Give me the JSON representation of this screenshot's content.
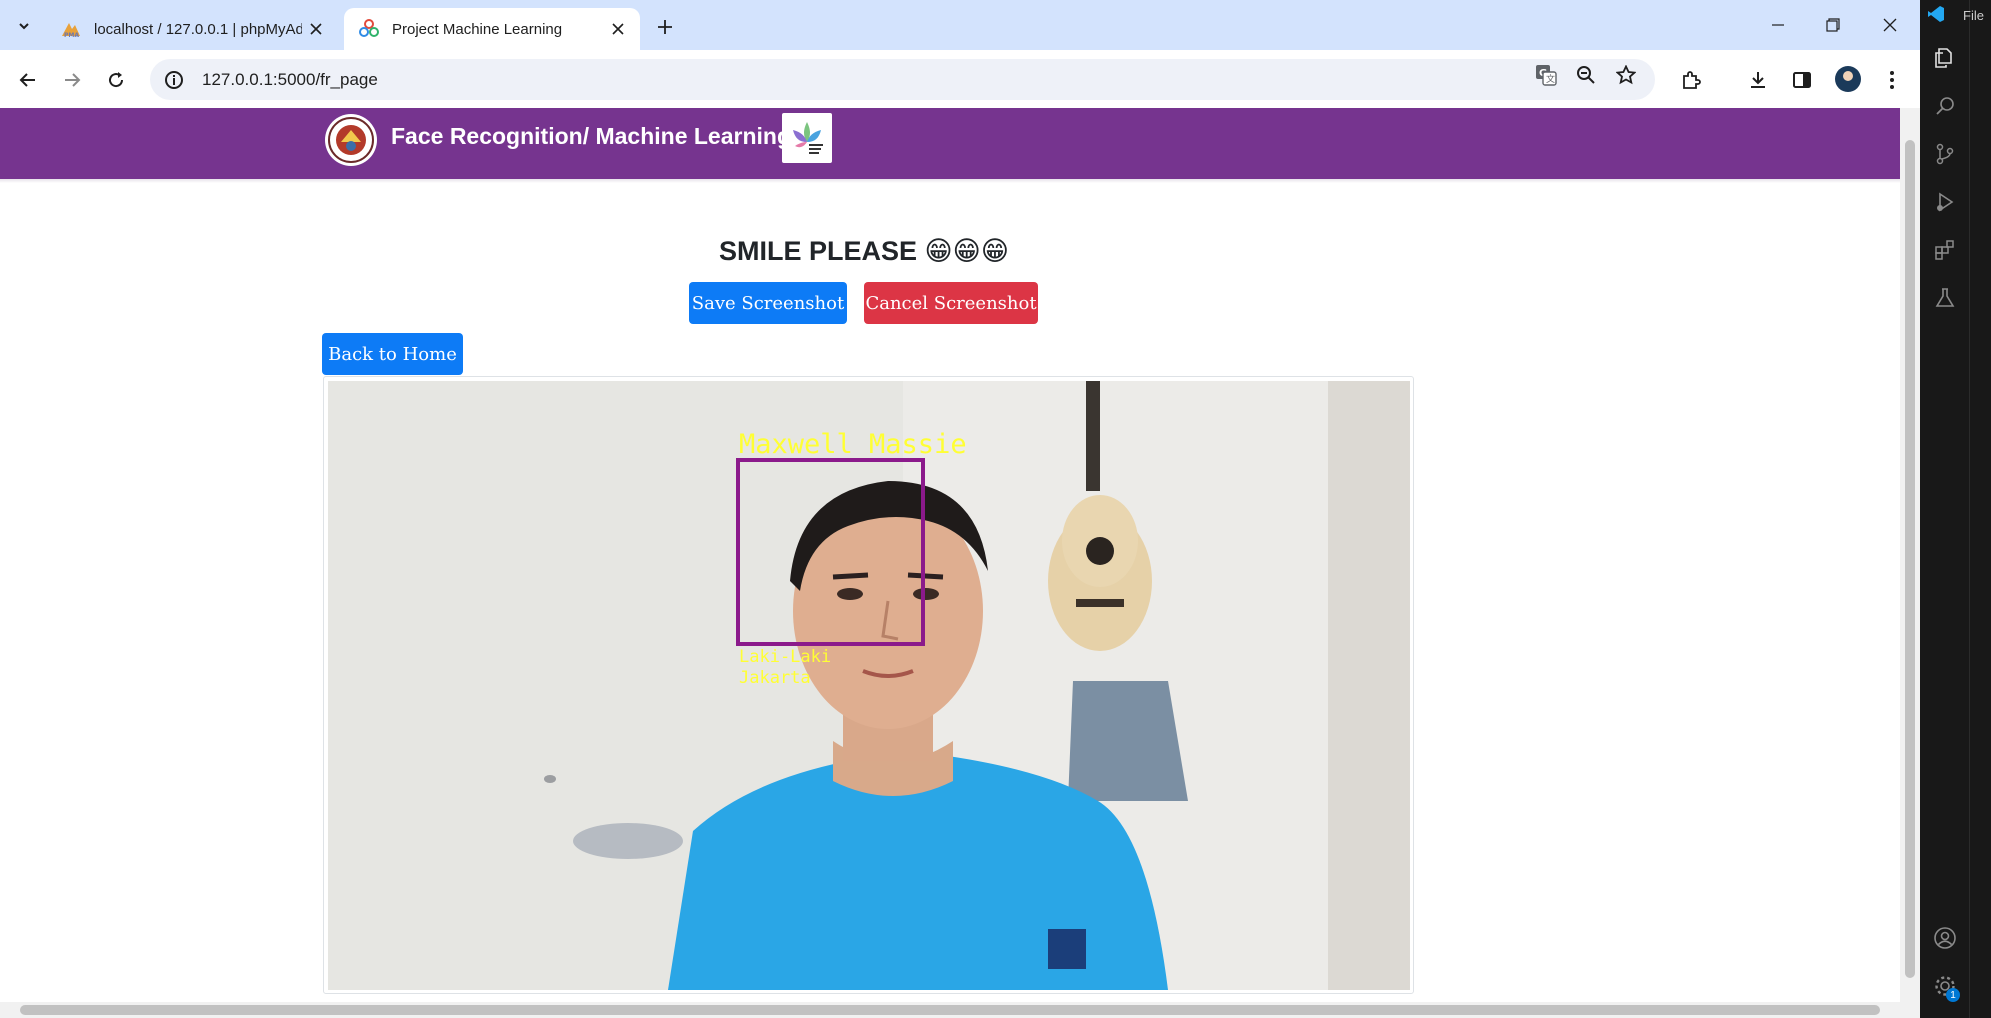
{
  "browser": {
    "tabs": [
      {
        "title": "localhost / 127.0.0.1 | phpMyAdmin",
        "favicon": "phpmyadmin-icon",
        "active": false
      },
      {
        "title": "Project Machine Learning",
        "favicon": "multicolor-flower-icon",
        "active": true
      }
    ],
    "url": "127.0.0.1:5000/fr_page"
  },
  "page": {
    "brand": "Face Recognition/ Machine Learning",
    "headline": "SMILE PLEASE 😁😁😁",
    "buttons": {
      "save": "Save Screenshot",
      "cancel": "Cancel Screenshot",
      "back": "Back to Home"
    },
    "detection": {
      "name": "Maxwell Massie",
      "gender": "Laki-Laki",
      "city": "Jakarta",
      "box_color": "#8b1a8b",
      "label_color": "#ffff33"
    }
  },
  "colors": {
    "navbar": "#76348f",
    "primary": "#0d7bf6",
    "danger": "#dc3545",
    "tabbar": "#d3e3fd"
  },
  "vscode": {
    "menu_label": "File"
  }
}
